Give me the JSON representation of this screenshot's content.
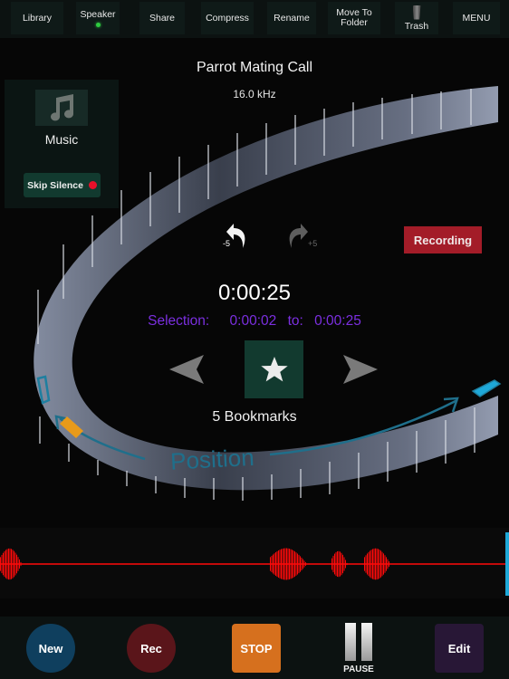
{
  "toolbar": {
    "items": [
      {
        "label": "Library"
      },
      {
        "label": "Speaker",
        "active": true
      },
      {
        "label": "Share"
      },
      {
        "label": "Compress"
      },
      {
        "label": "Rename"
      },
      {
        "label": "Move To Folder",
        "line1": "Move To",
        "line2": "Folder"
      },
      {
        "label": "Trash",
        "icon": "trash-icon"
      },
      {
        "label": "MENU"
      }
    ]
  },
  "recording": {
    "title": "Parrot Mating Call",
    "sample_rate": "16.0 kHz",
    "status_badge": "Recording",
    "current_time": "0:00:25",
    "selection": {
      "label": "Selection:",
      "start": "0:00:02",
      "to_label": "to:",
      "end": "0:00:25"
    },
    "bookmarks": "5 Bookmarks"
  },
  "side_panel": {
    "category_icon": "music-note-icon",
    "category_label": "Music",
    "skip_silence_label": "Skip Silence",
    "skip_silence_on": true
  },
  "jump": {
    "back_label": "-5",
    "forward_label": "+5"
  },
  "dial": {
    "label": "Position"
  },
  "bottom": {
    "new": "New",
    "rec": "Rec",
    "stop": "STOP",
    "pause": "PAUSE",
    "edit": "Edit"
  },
  "colors": {
    "accent_teal": "#1f6f8b",
    "record_red": "#a31c28",
    "selection_purple": "#7b2fe0",
    "waveform": "#ff0a0a",
    "stop_orange": "#d6701e"
  }
}
